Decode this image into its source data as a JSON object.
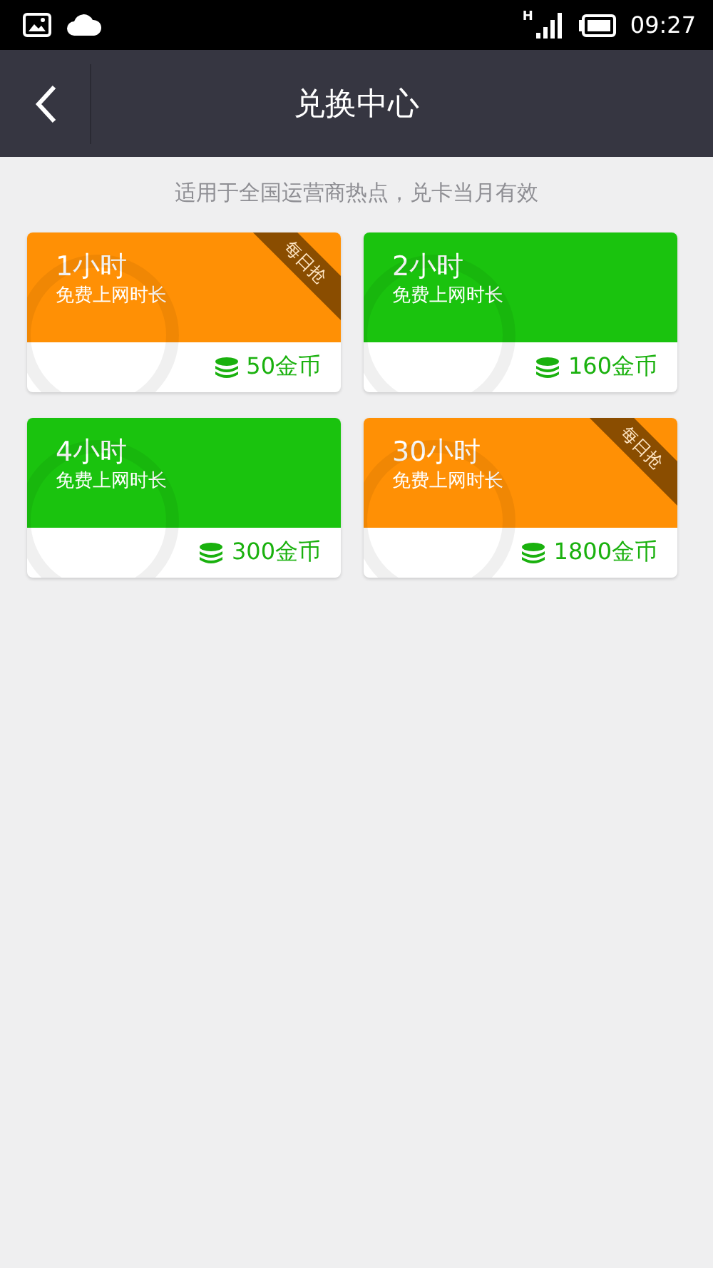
{
  "status_bar": {
    "network": "H",
    "time": "09:27"
  },
  "nav": {
    "title": "兑换中心"
  },
  "subtitle": "适用于全国运营商热点，兑卡当月有效",
  "cards": [
    {
      "duration": "1小时",
      "caption": "免费上网时长",
      "price": "50金币",
      "color": "#ff9005",
      "ribbon": "每日抢"
    },
    {
      "duration": "2小时",
      "caption": "免费上网时长",
      "price": "160金币",
      "color": "#1ac30e"
    },
    {
      "duration": "4小时",
      "caption": "免费上网时长",
      "price": "300金币",
      "color": "#1ac30e"
    },
    {
      "duration": "30小时",
      "caption": "免费上网时长",
      "price": "1800金币",
      "color": "#ff9005",
      "ribbon": "每日抢"
    }
  ]
}
